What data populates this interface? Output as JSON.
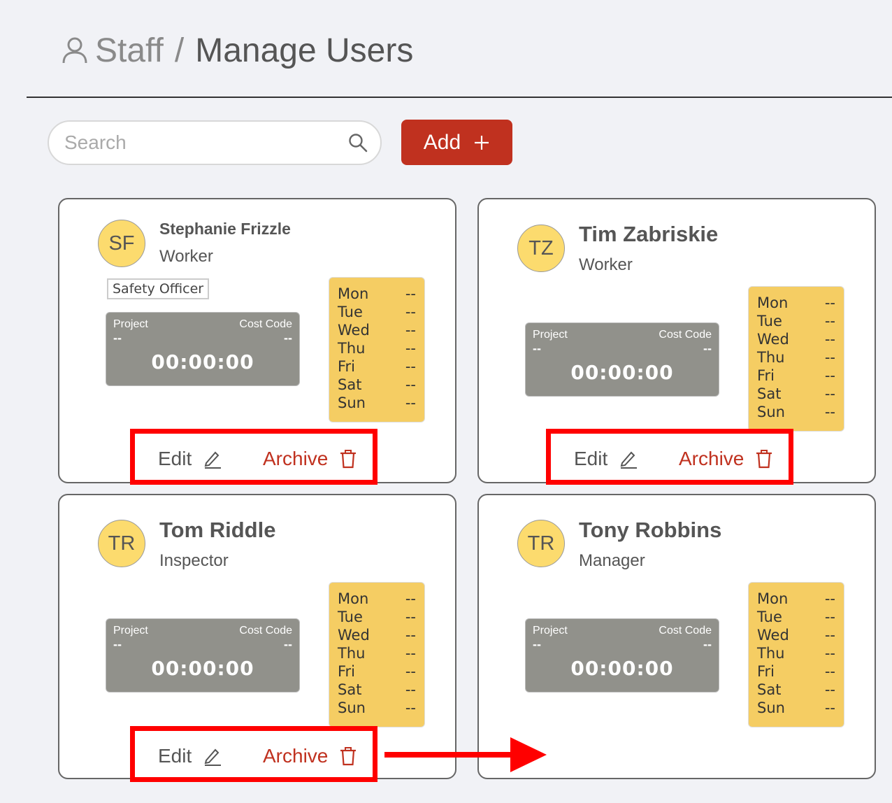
{
  "header": {
    "crumb": "Staff",
    "separator": "/",
    "title": "Manage Users",
    "icon": "user-icon"
  },
  "search": {
    "placeholder": "Search",
    "value": "",
    "icon": "search-icon"
  },
  "add_button": {
    "label": "Add",
    "icon": "plus-icon"
  },
  "colors": {
    "accent": "#c0311f",
    "avatar": "#fcdb6e",
    "timer": "#91918b",
    "schedule": "#f5cd63",
    "highlight": "#ff0000"
  },
  "timer_labels": {
    "project": "Project",
    "cost_code": "Cost Code"
  },
  "actions": {
    "edit": "Edit",
    "archive": "Archive"
  },
  "users": [
    {
      "initials": "SF",
      "name": "Stephanie Frizzle",
      "role": "Worker",
      "tag": "Safety Officer",
      "project": "--",
      "cost_code": "--",
      "time": "00:00:00",
      "schedule": [
        {
          "day": "Mon",
          "value": "--"
        },
        {
          "day": "Tue",
          "value": "--"
        },
        {
          "day": "Wed",
          "value": "--"
        },
        {
          "day": "Thu",
          "value": "--"
        },
        {
          "day": "Fri",
          "value": "--"
        },
        {
          "day": "Sat",
          "value": "--"
        },
        {
          "day": "Sun",
          "value": "--"
        }
      ]
    },
    {
      "initials": "TZ",
      "name": "Tim Zabriskie",
      "role": "Worker",
      "project": "--",
      "cost_code": "--",
      "time": "00:00:00",
      "schedule": [
        {
          "day": "Mon",
          "value": "--"
        },
        {
          "day": "Tue",
          "value": "--"
        },
        {
          "day": "Wed",
          "value": "--"
        },
        {
          "day": "Thu",
          "value": "--"
        },
        {
          "day": "Fri",
          "value": "--"
        },
        {
          "day": "Sat",
          "value": "--"
        },
        {
          "day": "Sun",
          "value": "--"
        }
      ]
    },
    {
      "initials": "TR",
      "name": "Tom Riddle",
      "role": "Inspector",
      "project": "--",
      "cost_code": "--",
      "time": "00:00:00",
      "schedule": [
        {
          "day": "Mon",
          "value": "--"
        },
        {
          "day": "Tue",
          "value": "--"
        },
        {
          "day": "Wed",
          "value": "--"
        },
        {
          "day": "Thu",
          "value": "--"
        },
        {
          "day": "Fri",
          "value": "--"
        },
        {
          "day": "Sat",
          "value": "--"
        },
        {
          "day": "Sun",
          "value": "--"
        }
      ]
    },
    {
      "initials": "TR",
      "name": "Tony Robbins",
      "role": "Manager",
      "project": "--",
      "cost_code": "--",
      "time": "00:00:00",
      "schedule": [
        {
          "day": "Mon",
          "value": "--"
        },
        {
          "day": "Tue",
          "value": "--"
        },
        {
          "day": "Wed",
          "value": "--"
        },
        {
          "day": "Thu",
          "value": "--"
        },
        {
          "day": "Fri",
          "value": "--"
        },
        {
          "day": "Sat",
          "value": "--"
        },
        {
          "day": "Sun",
          "value": "--"
        }
      ]
    }
  ]
}
